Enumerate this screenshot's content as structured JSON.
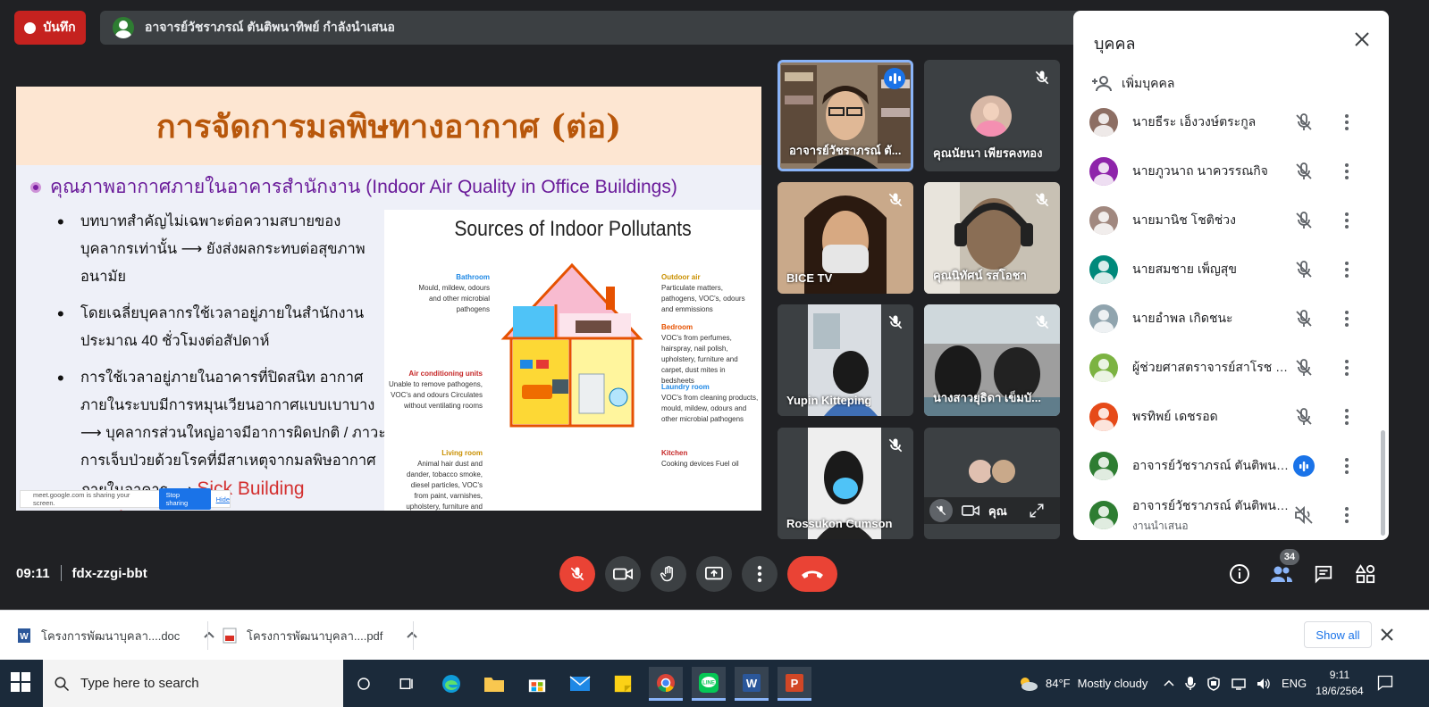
{
  "top": {
    "record_label": "บันทึก",
    "presenting_text": "อาจารย์วัชราภรณ์ ตันติพนาทิพย์ กำลังนำเสนอ"
  },
  "slide": {
    "title": "การจัดการมลพิษทางอากาศ (ต่อ)",
    "subtitle": "คุณภาพอากาศภายในอาคารสำนักงาน (Indoor Air Quality in Office Buildings)",
    "bullets": [
      "บทบาทสำคัญไม่เฉพาะต่อความสบายของบุคลากรเท่านั้น ⟶ ยังส่งผลกระทบต่อสุขภาพอนามัย",
      "โดยเฉลี่ยบุคลากรใช้เวลาอยู่ภายในสำนักงานประมาณ 40 ชั่วโมงต่อสัปดาห์",
      "การใช้เวลาอยู่ภายในอาคารที่ปิดสนิท อากาศภายในระบบมีการหมุนเวียนอากาศแบบเบาบาง ⟶ บุคลากรส่วนใหญ่อาจมีอาการผิดปกติ / ภาวะการเจ็บป่วยด้วยโรคที่มีสาเหตุจากมลพิษอากาศภายในอาคาร ⟶"
    ],
    "syndrome": "Sick Building Syndrome",
    "share_notice": "meet.google.com is sharing your screen.",
    "stop_sharing": "Stop sharing",
    "hide": "Hide",
    "infographic": {
      "title": "Sources of Indoor Pollutants",
      "bathroom_h": "Bathroom",
      "bathroom_t": "Mould, mildew, odours and other microbial pathogens",
      "ac_h": "Air conditioning units",
      "ac_t": "Unable to remove pathogens, VOC's and odours Circulates without ventilating rooms",
      "living_h": "Living room",
      "living_t": "Animal hair dust and dander, tobacco smoke, diesel particles, VOC's from paint, varnishes, upholstery, furniture and carpet",
      "outdoor_h": "Outdoor air",
      "outdoor_t": "Particulate matters, pathogens, VOC's, odours and emmissions",
      "bedroom_h": "Bedroom",
      "bedroom_t": "VOC's from perfumes, hairspray, nail polish, upholstery, furniture and carpet, dust mites in bedsheets",
      "laundry_h": "Laundry room",
      "laundry_t": "VOC's from cleaning products, mould, mildew, odours and other microbial pathogens",
      "kitchen_h": "Kitchen",
      "kitchen_t": "Cooking devices Fuel oil"
    }
  },
  "tiles": [
    {
      "name": "อาจารย์วัชราภรณ์ ตั...",
      "speaking": true
    },
    {
      "name": "คุณนัยนา เพียรคงทอง",
      "muted": true
    },
    {
      "name": "BICE TV",
      "muted": true
    },
    {
      "name": "คุณนิทัศน์ รสโอชา",
      "muted": true
    },
    {
      "name": "Yupin Kitteping",
      "muted": true
    },
    {
      "name": "นางสาวยุธิดา เข็มบั...",
      "muted": true
    },
    {
      "name": "Rossukon Cumson",
      "muted": true
    },
    {
      "name": "คุณ"
    }
  ],
  "panel": {
    "title": "บุคคล",
    "add_people": "เพิ่มบุคคล",
    "people": [
      {
        "name": "นายธีระ เอ็งวงษ์ตระกูล",
        "color": "#8d6e63",
        "mic": "muted"
      },
      {
        "name": "นายภูวนาถ นาควรรณกิจ",
        "color": "#8e24aa",
        "mic": "muted"
      },
      {
        "name": "นายมานิช โชติช่วง",
        "color": "#a1887f",
        "mic": "muted"
      },
      {
        "name": "นายสมชาย เพ็ญสุข",
        "color": "#00897b",
        "mic": "muted"
      },
      {
        "name": "นายอำพล เกิดชนะ",
        "color": "#90a4ae",
        "mic": "muted"
      },
      {
        "name": "ผู้ช่วยศาสตราจารย์สาโรช ปริ...",
        "color": "#7cb342",
        "mic": "muted"
      },
      {
        "name": "พรทิพย์ เดชรอด",
        "color": "#e64a19",
        "mic": "muted"
      },
      {
        "name": "อาจารย์วัชราภรณ์ ตันติพนา...",
        "color": "#2e7d32",
        "mic": "speaking"
      },
      {
        "name": "อาจารย์วัชราภรณ์ ตันติพนา...",
        "sub": "งานนำเสนอ",
        "color": "#2e7d32",
        "mic": "off"
      }
    ]
  },
  "bottom": {
    "time": "09:11",
    "code": "fdx-zzgi-bbt",
    "people_count": "34"
  },
  "downloads": [
    {
      "name": "โครงการพัฒนาบุคลา....doc",
      "type": "word-icon"
    },
    {
      "name": "โครงการพัฒนาบุคลา....pdf",
      "type": "pdf-icon"
    }
  ],
  "show_all": "Show all",
  "taskbar": {
    "search_placeholder": "Type here to search",
    "temp": "84°F",
    "weather": "Mostly cloudy",
    "lang": "ENG",
    "time": "9:11",
    "date": "18/6/2564"
  },
  "colors": {
    "meet_bg": "#202124",
    "record_red": "#c5221f",
    "hangup_red": "#ea4335",
    "accent_blue": "#1a73e8"
  }
}
